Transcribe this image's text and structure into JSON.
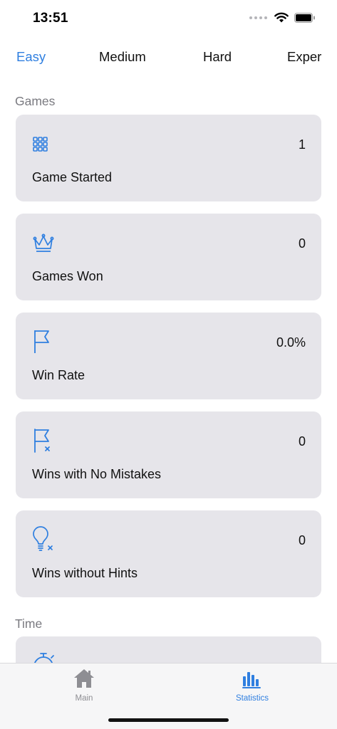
{
  "status": {
    "time": "13:51"
  },
  "difficulty_tabs": [
    {
      "label": "Easy",
      "selected": true
    },
    {
      "label": "Medium",
      "selected": false
    },
    {
      "label": "Hard",
      "selected": false
    },
    {
      "label": "Exper",
      "selected": false
    }
  ],
  "sections": {
    "games": "Games",
    "time": "Time"
  },
  "cards": [
    {
      "icon": "grid-icon",
      "label": "Game Started",
      "value": "1"
    },
    {
      "icon": "crown-icon",
      "label": "Games Won",
      "value": "0"
    },
    {
      "icon": "flag-icon",
      "label": "Win Rate",
      "value": "0.0%"
    },
    {
      "icon": "flag-x-icon",
      "label": "Wins with No Mistakes",
      "value": "0"
    },
    {
      "icon": "lightbulb-x-icon",
      "label": "Wins without Hints",
      "value": "0"
    }
  ],
  "tab_bar": {
    "main": "Main",
    "statistics": "Statistics",
    "active": "statistics"
  },
  "colors": {
    "accent": "#2f7fe0",
    "card_bg": "#e6e5ea",
    "section_label": "#7a7a80",
    "inactive_tab": "#8e8e93"
  }
}
